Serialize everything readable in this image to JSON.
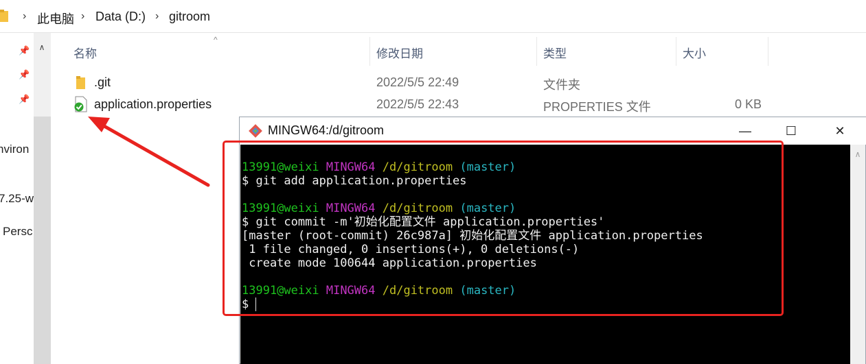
{
  "breadcrumb": {
    "items": [
      "此电脑",
      "Data (D:)",
      "gitroom"
    ]
  },
  "left_nav": {
    "labels": [
      "nviron",
      "7.25-w",
      "Persc"
    ]
  },
  "columns": {
    "name": "名称",
    "modified": "修改日期",
    "type": "类型",
    "size": "大小"
  },
  "files": [
    {
      "name": ".git",
      "modified": "2022/5/5 22:49",
      "type": "文件夹",
      "size": "",
      "icon": "folder-icon"
    },
    {
      "name": "application.properties",
      "modified": "2022/5/5 22:43",
      "type": "PROPERTIES 文件",
      "size": "0 KB",
      "icon": "git-tracked-file-icon"
    }
  ],
  "terminal": {
    "title": "MINGW64:/d/gitroom",
    "prompt": {
      "user": "13991@weixi",
      "system": "MINGW64",
      "path": "/d/gitroom",
      "branch": "(master)"
    },
    "commands": [
      {
        "cmd": "$ git add application.properties"
      },
      {
        "cmd": "$ git commit -m'初始化配置文件 application.properties'",
        "output": [
          "[master (root-commit) 26c987a] 初始化配置文件 application.properties",
          " 1 file changed, 0 insertions(+), 0 deletions(-)",
          " create mode 100644 application.properties"
        ]
      }
    ],
    "final_prompt": "$ ",
    "controls": {
      "minimize": "—",
      "maximize": "☐",
      "close": "✕"
    }
  },
  "colors": {
    "annotation_red": "#e8231f",
    "prompt_green": "#1ec31e",
    "prompt_magenta": "#c134c1",
    "prompt_yellow": "#c0bf22",
    "prompt_cyan": "#2ab7c2"
  }
}
